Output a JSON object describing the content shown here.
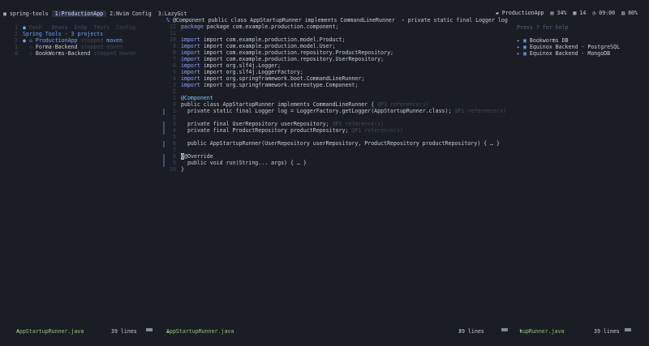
{
  "session": {
    "name": "spring-tools"
  },
  "tabs": [
    {
      "label": "1:ProductionApp",
      "active": true
    },
    {
      "label": "2:Nvim Config",
      "active": false
    },
    {
      "label": "3:LazyGit",
      "active": false
    }
  ],
  "status": {
    "project": "ProductionApp",
    "battery": "34%",
    "date": "14",
    "time": "09:00",
    "level": "80%"
  },
  "left_pane": {
    "menu": "Dash   Beans  Endp  Tests  Config",
    "title": "Spring Tools - 3 projects",
    "projects": [
      {
        "num": "2",
        "name": "ProductionApp",
        "state": "stopped",
        "build": "maven"
      },
      {
        "num": "1",
        "name": "Forma-Backend",
        "state": "stopped",
        "build": "maven"
      },
      {
        "num": "8",
        "name": "BookWorms-Backend",
        "state": "stopped",
        "build": "maven"
      }
    ]
  },
  "editor": {
    "breadcrumb": "@Component public class AppStartupRunner implements CommandLineRunner  › private static final Logger log",
    "lines": [
      "package com.example.production.component;",
      "",
      "import com.example.production.model.Product;",
      "import com.example.production.model.User;",
      "import com.example.production.repository.ProductRepository;",
      "import com.example.production.repository.UserRepository;",
      "import org.slf4j.Logger;",
      "import org.slf4j.LoggerFactory;",
      "import org.springframework.boot.CommandLineRunner;",
      "import org.springframework.stereotype.Component;",
      "",
      "@Component",
      "public class AppStartupRunner implements CommandLineRunner {",
      "  private static final Logger log = LoggerFactory.getLogger(AppStartupRunner.class);",
      "",
      "  private final UserRepository userRepository;",
      "  private final ProductRepository productRepository;",
      "",
      "  public AppStartupRunner(UserRepository userRepository, ProductRepository productRepository) { … }",
      "",
      "@Override",
      "  public void run(String... args) { … }",
      "}"
    ],
    "refs": [
      {
        "line": 12,
        "text": "@P1 reference(s)"
      },
      {
        "line": 13,
        "text": "@P1 reference(s)"
      },
      {
        "line": 15,
        "text": "@P1 reference(s)"
      },
      {
        "line": 16,
        "text": "@P1 reference(s)"
      }
    ]
  },
  "right_pane": {
    "hint": "Press ? for help",
    "items": [
      "Bookworms DB",
      "Equinox Backend - PostgreSQL",
      "Equinox Backend - MongoDB"
    ]
  },
  "bottom": {
    "left_file": "AppStartupRunner.java",
    "left_lines": "39 lines",
    "mid_file": "AppStartupRunner.java",
    "mid_lines": "39 lines",
    "right_file": "tupRunner.java",
    "right_lines": "39 lines"
  }
}
